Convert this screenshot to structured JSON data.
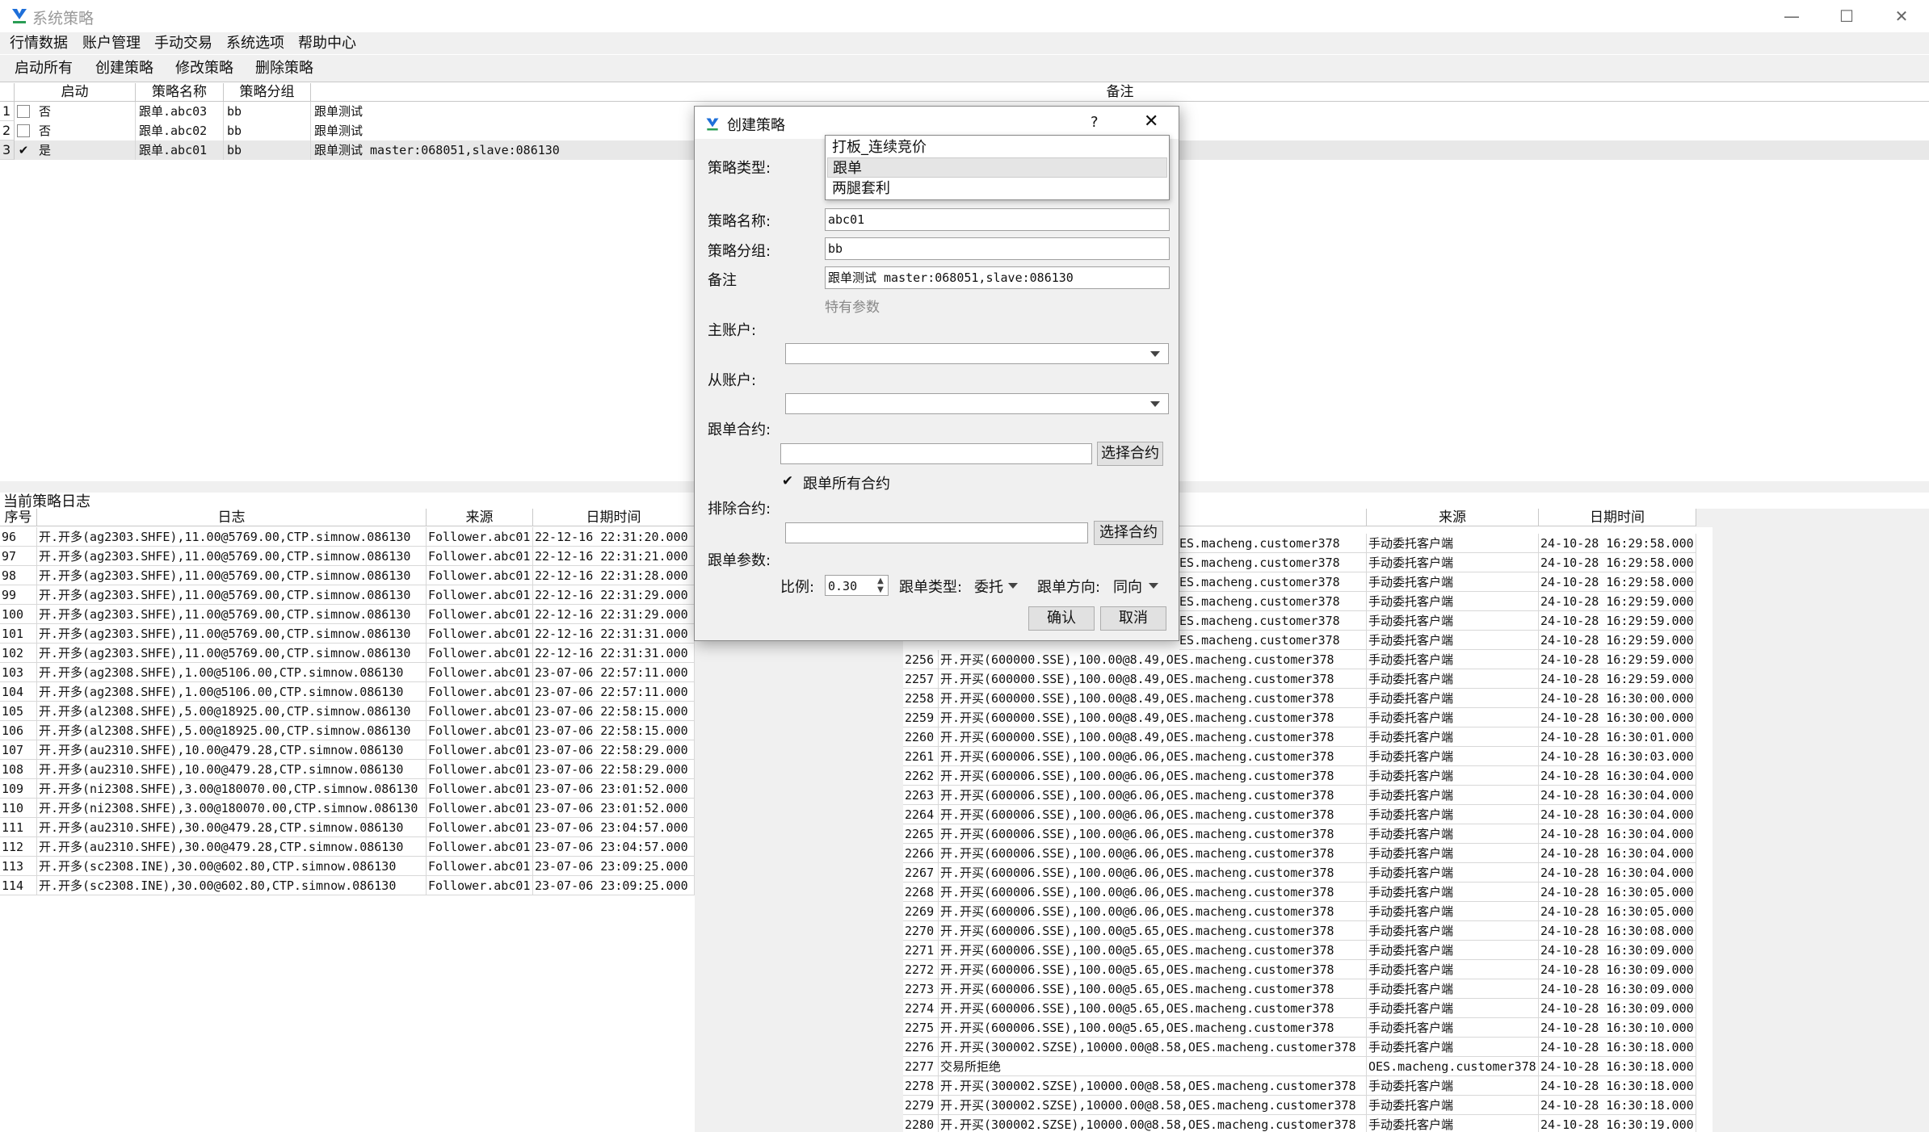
{
  "window": {
    "title": "系统策略",
    "controls": [
      "—",
      "☐",
      "✕"
    ]
  },
  "menu": [
    "行情数据",
    "账户管理",
    "手动交易",
    "系统选项",
    "帮助中心"
  ],
  "toolbar": [
    "启动所有",
    "创建策略",
    "修改策略",
    "删除策略"
  ],
  "strategy_table": {
    "headers": [
      "启动",
      "策略名称",
      "策略分组",
      "备注"
    ],
    "rows": [
      {
        "idx": "1",
        "checked": false,
        "start": "否",
        "name": "跟单.abc03",
        "group": "bb",
        "note": "跟单测试"
      },
      {
        "idx": "2",
        "checked": false,
        "start": "否",
        "name": "跟单.abc02",
        "group": "bb",
        "note": "跟单测试"
      },
      {
        "idx": "3",
        "checked": true,
        "start": "是",
        "name": "跟单.abc01",
        "group": "bb",
        "note": "跟单测试 master:068051,slave:086130"
      }
    ]
  },
  "log_panel": {
    "title": "当前策略日志",
    "headers": [
      "序号",
      "日志",
      "来源",
      "日期时间"
    ],
    "rows": [
      [
        "96",
        "开.开多(ag2303.SHFE),11.00@5769.00,CTP.simnow.086130",
        "Follower.abc01",
        "22-12-16 22:31:20.000"
      ],
      [
        "97",
        "开.开多(ag2303.SHFE),11.00@5769.00,CTP.simnow.086130",
        "Follower.abc01",
        "22-12-16 22:31:21.000"
      ],
      [
        "98",
        "开.开多(ag2303.SHFE),11.00@5769.00,CTP.simnow.086130",
        "Follower.abc01",
        "22-12-16 22:31:28.000"
      ],
      [
        "99",
        "开.开多(ag2303.SHFE),11.00@5769.00,CTP.simnow.086130",
        "Follower.abc01",
        "22-12-16 22:31:29.000"
      ],
      [
        "100",
        "开.开多(ag2303.SHFE),11.00@5769.00,CTP.simnow.086130",
        "Follower.abc01",
        "22-12-16 22:31:29.000"
      ],
      [
        "101",
        "开.开多(ag2303.SHFE),11.00@5769.00,CTP.simnow.086130",
        "Follower.abc01",
        "22-12-16 22:31:31.000"
      ],
      [
        "102",
        "开.开多(ag2303.SHFE),11.00@5769.00,CTP.simnow.086130",
        "Follower.abc01",
        "22-12-16 22:31:31.000"
      ],
      [
        "103",
        "开.开多(ag2308.SHFE),1.00@5106.00,CTP.simnow.086130",
        "Follower.abc01",
        "23-07-06 22:57:11.000"
      ],
      [
        "104",
        "开.开多(ag2308.SHFE),1.00@5106.00,CTP.simnow.086130",
        "Follower.abc01",
        "23-07-06 22:57:11.000"
      ],
      [
        "105",
        "开.开多(al2308.SHFE),5.00@18925.00,CTP.simnow.086130",
        "Follower.abc01",
        "23-07-06 22:58:15.000"
      ],
      [
        "106",
        "开.开多(al2308.SHFE),5.00@18925.00,CTP.simnow.086130",
        "Follower.abc01",
        "23-07-06 22:58:15.000"
      ],
      [
        "107",
        "开.开多(au2310.SHFE),10.00@479.28,CTP.simnow.086130",
        "Follower.abc01",
        "23-07-06 22:58:29.000"
      ],
      [
        "108",
        "开.开多(au2310.SHFE),10.00@479.28,CTP.simnow.086130",
        "Follower.abc01",
        "23-07-06 22:58:29.000"
      ],
      [
        "109",
        "开.开多(ni2308.SHFE),3.00@180070.00,CTP.simnow.086130",
        "Follower.abc01",
        "23-07-06 23:01:52.000"
      ],
      [
        "110",
        "开.开多(ni2308.SHFE),3.00@180070.00,CTP.simnow.086130",
        "Follower.abc01",
        "23-07-06 23:01:52.000"
      ],
      [
        "111",
        "开.开多(au2310.SHFE),30.00@479.28,CTP.simnow.086130",
        "Follower.abc01",
        "23-07-06 23:04:57.000"
      ],
      [
        "112",
        "开.开多(au2310.SHFE),30.00@479.28,CTP.simnow.086130",
        "Follower.abc01",
        "23-07-06 23:04:57.000"
      ],
      [
        "113",
        "开.开多(sc2308.INE),30.00@602.80,CTP.simnow.086130",
        "Follower.abc01",
        "23-07-06 23:09:25.000"
      ],
      [
        "114",
        "开.开多(sc2308.INE),30.00@602.80,CTP.simnow.086130",
        "Follower.abc01",
        "23-07-06 23:09:25.000"
      ]
    ]
  },
  "system_log": {
    "headers": [
      "来源",
      "日期时间"
    ],
    "partial_rows": [
      [
        "ES.macheng.customer378",
        "手动委托客户端",
        "24-10-28 16:29:58.000"
      ],
      [
        "ES.macheng.customer378",
        "手动委托客户端",
        "24-10-28 16:29:58.000"
      ],
      [
        "ES.macheng.customer378",
        "手动委托客户端",
        "24-10-28 16:29:58.000"
      ],
      [
        "ES.macheng.customer378",
        "手动委托客户端",
        "24-10-28 16:29:59.000"
      ],
      [
        "ES.macheng.customer378",
        "手动委托客户端",
        "24-10-28 16:29:59.000"
      ],
      [
        "ES.macheng.customer378",
        "手动委托客户端",
        "24-10-28 16:29:59.000"
      ]
    ],
    "rows": [
      [
        "2256",
        "开.开买(600000.SSE),100.00@8.49,OES.macheng.customer378",
        "手动委托客户端",
        "24-10-28 16:29:59.000"
      ],
      [
        "2257",
        "开.开买(600000.SSE),100.00@8.49,OES.macheng.customer378",
        "手动委托客户端",
        "24-10-28 16:29:59.000"
      ],
      [
        "2258",
        "开.开买(600000.SSE),100.00@8.49,OES.macheng.customer378",
        "手动委托客户端",
        "24-10-28 16:30:00.000"
      ],
      [
        "2259",
        "开.开买(600000.SSE),100.00@8.49,OES.macheng.customer378",
        "手动委托客户端",
        "24-10-28 16:30:00.000"
      ],
      [
        "2260",
        "开.开买(600000.SSE),100.00@8.49,OES.macheng.customer378",
        "手动委托客户端",
        "24-10-28 16:30:01.000"
      ],
      [
        "2261",
        "开.开买(600006.SSE),100.00@6.06,OES.macheng.customer378",
        "手动委托客户端",
        "24-10-28 16:30:03.000"
      ],
      [
        "2262",
        "开.开买(600006.SSE),100.00@6.06,OES.macheng.customer378",
        "手动委托客户端",
        "24-10-28 16:30:04.000"
      ],
      [
        "2263",
        "开.开买(600006.SSE),100.00@6.06,OES.macheng.customer378",
        "手动委托客户端",
        "24-10-28 16:30:04.000"
      ],
      [
        "2264",
        "开.开买(600006.SSE),100.00@6.06,OES.macheng.customer378",
        "手动委托客户端",
        "24-10-28 16:30:04.000"
      ],
      [
        "2265",
        "开.开买(600006.SSE),100.00@6.06,OES.macheng.customer378",
        "手动委托客户端",
        "24-10-28 16:30:04.000"
      ],
      [
        "2266",
        "开.开买(600006.SSE),100.00@6.06,OES.macheng.customer378",
        "手动委托客户端",
        "24-10-28 16:30:04.000"
      ],
      [
        "2267",
        "开.开买(600006.SSE),100.00@6.06,OES.macheng.customer378",
        "手动委托客户端",
        "24-10-28 16:30:04.000"
      ],
      [
        "2268",
        "开.开买(600006.SSE),100.00@6.06,OES.macheng.customer378",
        "手动委托客户端",
        "24-10-28 16:30:05.000"
      ],
      [
        "2269",
        "开.开买(600006.SSE),100.00@6.06,OES.macheng.customer378",
        "手动委托客户端",
        "24-10-28 16:30:05.000"
      ],
      [
        "2270",
        "开.开买(600006.SSE),100.00@5.65,OES.macheng.customer378",
        "手动委托客户端",
        "24-10-28 16:30:08.000"
      ],
      [
        "2271",
        "开.开买(600006.SSE),100.00@5.65,OES.macheng.customer378",
        "手动委托客户端",
        "24-10-28 16:30:09.000"
      ],
      [
        "2272",
        "开.开买(600006.SSE),100.00@5.65,OES.macheng.customer378",
        "手动委托客户端",
        "24-10-28 16:30:09.000"
      ],
      [
        "2273",
        "开.开买(600006.SSE),100.00@5.65,OES.macheng.customer378",
        "手动委托客户端",
        "24-10-28 16:30:09.000"
      ],
      [
        "2274",
        "开.开买(600006.SSE),100.00@5.65,OES.macheng.customer378",
        "手动委托客户端",
        "24-10-28 16:30:09.000"
      ],
      [
        "2275",
        "开.开买(600006.SSE),100.00@5.65,OES.macheng.customer378",
        "手动委托客户端",
        "24-10-28 16:30:10.000"
      ],
      [
        "2276",
        "开.开买(300002.SZSE),10000.00@8.58,OES.macheng.customer378",
        "手动委托客户端",
        "24-10-28 16:30:18.000"
      ],
      [
        "2277",
        "交易所拒绝",
        "OES.macheng.customer378",
        "24-10-28 16:30:18.000"
      ],
      [
        "2278",
        "开.开买(300002.SZSE),10000.00@8.58,OES.macheng.customer378",
        "手动委托客户端",
        "24-10-28 16:30:18.000"
      ],
      [
        "2279",
        "开.开买(300002.SZSE),10000.00@8.58,OES.macheng.customer378",
        "手动委托客户端",
        "24-10-28 16:30:18.000"
      ],
      [
        "2280",
        "开.开买(300002.SZSE),10000.00@8.58,OES.macheng.customer378",
        "手动委托客户端",
        "24-10-28 16:30:19.000"
      ]
    ]
  },
  "dialog": {
    "title": "创建策略",
    "help": "?",
    "close": "✕",
    "type_label": "策略类型:",
    "type_options": [
      "打板_连续竞价",
      "跟单",
      "两腿套利"
    ],
    "type_selected_index": 1,
    "name_label": "策略名称:",
    "name_value": "abc01",
    "group_label": "策略分组:",
    "group_value": "bb",
    "note_label": "备注",
    "note_value": "跟单测试 master:068051,slave:086130",
    "special_params": "特有参数",
    "master_label": "主账户:",
    "slave_label": "从账户:",
    "follow_contract_label": "跟单合约:",
    "select_contract": "选择合约",
    "follow_all_label": "跟单所有合约",
    "follow_all_checked": true,
    "exclude_label": "排除合约:",
    "params_label": "跟单参数:",
    "ratio_label": "比例:",
    "ratio_value": "0.30",
    "order_type_label": "跟单类型:",
    "order_type_value": "委托",
    "direction_label": "跟单方向:",
    "direction_value": "同向",
    "confirm": "确认",
    "cancel": "取消"
  }
}
